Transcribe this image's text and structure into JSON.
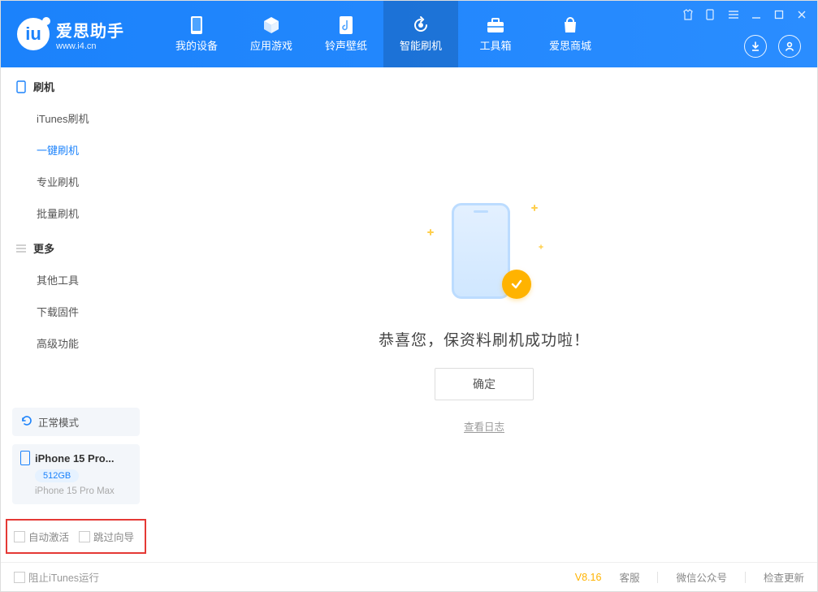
{
  "brand": {
    "name": "爱思助手",
    "url": "www.i4.cn"
  },
  "nav": {
    "items": [
      {
        "label": "我的设备",
        "icon": "phone-icon"
      },
      {
        "label": "应用游戏",
        "icon": "cube-icon"
      },
      {
        "label": "铃声壁纸",
        "icon": "music-icon"
      },
      {
        "label": "智能刷机",
        "icon": "refresh-icon",
        "active": true
      },
      {
        "label": "工具箱",
        "icon": "toolbox-icon"
      },
      {
        "label": "爱思商城",
        "icon": "bag-icon"
      }
    ]
  },
  "sidebar": {
    "group1": {
      "title": "刷机",
      "items": [
        "iTunes刷机",
        "一键刷机",
        "专业刷机",
        "批量刷机"
      ],
      "active_index": 1
    },
    "group2": {
      "title": "更多",
      "items": [
        "其他工具",
        "下载固件",
        "高级功能"
      ]
    },
    "mode_label": "正常模式",
    "device": {
      "name_short": "iPhone 15 Pro...",
      "storage": "512GB",
      "name_full": "iPhone 15 Pro Max"
    },
    "flags": {
      "auto_activate": "自动激活",
      "skip_wizard": "跳过向导"
    }
  },
  "main": {
    "success_message": "恭喜您，保资料刷机成功啦！",
    "ok_button": "确定",
    "view_log": "查看日志"
  },
  "footer": {
    "block_itunes": "阻止iTunes运行",
    "version": "V8.16",
    "links": [
      "客服",
      "微信公众号",
      "检查更新"
    ]
  }
}
